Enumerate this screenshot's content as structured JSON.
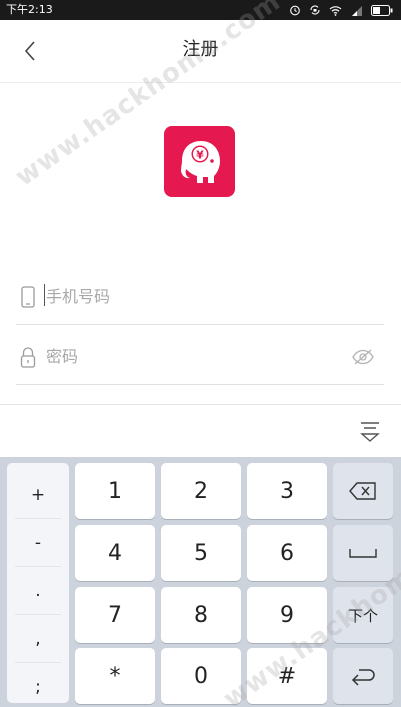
{
  "status_bar": {
    "time": "下午2:13",
    "icons": [
      "alarm-icon",
      "rotation-lock-icon",
      "wifi-icon",
      "signal-icon",
      "battery-icon"
    ]
  },
  "header": {
    "back_icon": "chevron-left-icon",
    "title": "注册"
  },
  "logo": {
    "symbol": "¥",
    "color": "#e5184f"
  },
  "form": {
    "phone": {
      "icon": "phone-icon",
      "placeholder": "手机号码",
      "value": ""
    },
    "password": {
      "icon": "lock-icon",
      "placeholder": "密码",
      "value": "",
      "toggle_icon": "eye-hidden-icon"
    }
  },
  "keyboard": {
    "collapse_icon": "keyboard-collapse-icon",
    "symbols": [
      "+",
      "-",
      ".",
      ",",
      ";"
    ],
    "keys": [
      "1",
      "2",
      "3",
      "4",
      "5",
      "6",
      "7",
      "8",
      "9",
      "*",
      "0",
      "#"
    ],
    "function_keys": {
      "backspace_icon": "backspace-icon",
      "space_icon": "space-icon",
      "next_label": "下个",
      "enter_icon": "enter-icon"
    }
  },
  "watermark": {
    "text": "www.hackhome.com"
  }
}
